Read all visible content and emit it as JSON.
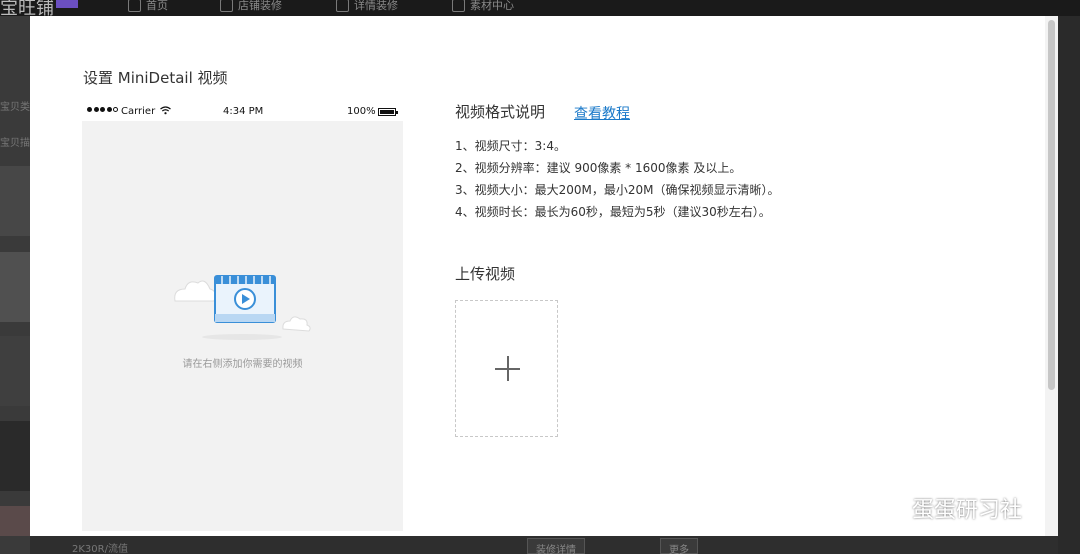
{
  "background_app": {
    "logo": "宝旺铺",
    "nav": [
      {
        "icon": "home-icon",
        "label": "首页"
      },
      {
        "icon": "store-icon",
        "label": "店铺装修"
      },
      {
        "icon": "document-icon",
        "label": "详情装修"
      },
      {
        "icon": "image-icon",
        "label": "素材中心"
      }
    ],
    "left_texts": [
      "宝贝类",
      "宝贝描"
    ],
    "bottom_text": "2K30R/流值",
    "bottom_buttons": [
      "装修详情",
      "更多"
    ]
  },
  "modal": {
    "title": "设置 MiniDetail 视频",
    "phone_preview": {
      "carrier": "Carrier",
      "time": "4:34 PM",
      "battery": "100%",
      "empty_hint": "请在右侧添加你需要的视频"
    },
    "format": {
      "title": "视频格式说明",
      "tutorial_link": "查看教程",
      "rules": [
        "1、视频尺寸：3:4。",
        "2、视频分辨率：建议 900像素 * 1600像素 及以上。",
        "3、视频大小：最大200M，最小20M（确保视频显示清晰）。",
        "4、视频时长：最长为60秒，最短为5秒（建议30秒左右）。"
      ]
    },
    "upload": {
      "title": "上传视频"
    }
  },
  "watermark": "蛋蛋研习社",
  "colors": {
    "link": "#1a79c9",
    "illustration": "#3a8fd8",
    "overlay_bg": "#2b2b2b"
  }
}
